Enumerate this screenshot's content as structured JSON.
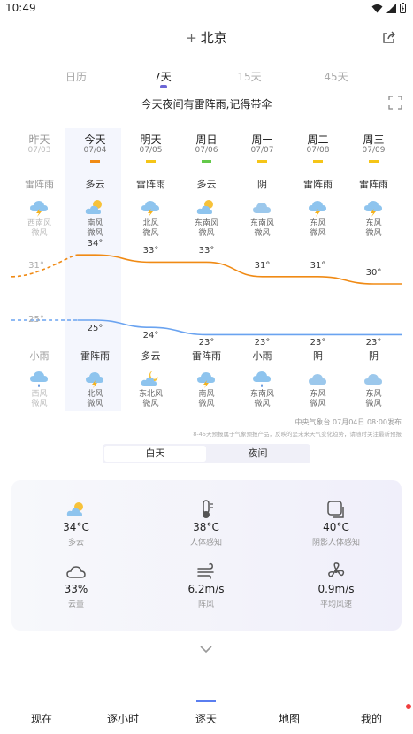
{
  "status_bar": {
    "time": "10:49"
  },
  "header": {
    "plus": "+",
    "city": "北京"
  },
  "tabs": [
    "日历",
    "7天",
    "15天",
    "45天"
  ],
  "notice": "今天夜间有雷阵雨,记得带伞",
  "forecast": [
    {
      "day": "昨天",
      "date": "07/03",
      "bar_color": "",
      "day_cond": "雷阵雨",
      "day_icon": "thunderstorm-icon",
      "day_wind": "西南风",
      "day_level": "微风",
      "high": "31°",
      "low": "25°",
      "night_cond": "小雨",
      "night_icon": "light-rain-icon",
      "night_wind": "西风",
      "night_level": "微风"
    },
    {
      "day": "今天",
      "date": "07/04",
      "bar_color": "#f08a14",
      "day_cond": "多云",
      "day_icon": "partly-cloudy-icon",
      "day_wind": "南风",
      "day_level": "微风",
      "high": "34°",
      "low": "25°",
      "night_cond": "雷阵雨",
      "night_icon": "thunderstorm-icon",
      "night_wind": "北风",
      "night_level": "微风"
    },
    {
      "day": "明天",
      "date": "07/05",
      "bar_color": "#f5c518",
      "day_cond": "雷阵雨",
      "day_icon": "thunderstorm-icon",
      "day_wind": "北风",
      "day_level": "微风",
      "high": "33°",
      "low": "24°",
      "night_cond": "多云",
      "night_icon": "partly-cloudy-night-icon",
      "night_wind": "东北风",
      "night_level": "微风"
    },
    {
      "day": "周日",
      "date": "07/06",
      "bar_color": "#63c94a",
      "day_cond": "多云",
      "day_icon": "partly-cloudy-icon",
      "day_wind": "东南风",
      "day_level": "微风",
      "high": "33°",
      "low": "23°",
      "night_cond": "雷阵雨",
      "night_icon": "thunderstorm-icon",
      "night_wind": "南风",
      "night_level": "微风"
    },
    {
      "day": "周一",
      "date": "07/07",
      "bar_color": "#f5c518",
      "day_cond": "阴",
      "day_icon": "overcast-icon",
      "day_wind": "东南风",
      "day_level": "微风",
      "high": "31°",
      "low": "23°",
      "night_cond": "小雨",
      "night_icon": "light-rain-icon",
      "night_wind": "东南风",
      "night_level": "微风"
    },
    {
      "day": "周二",
      "date": "07/08",
      "bar_color": "#f5c518",
      "day_cond": "雷阵雨",
      "day_icon": "thunderstorm-icon",
      "day_wind": "东风",
      "day_level": "微风",
      "high": "31°",
      "low": "23°",
      "night_cond": "阴",
      "night_icon": "overcast-icon",
      "night_wind": "东风",
      "night_level": "微风"
    },
    {
      "day": "周三",
      "date": "07/09",
      "bar_color": "#f5c518",
      "day_cond": "雷阵雨",
      "day_icon": "thunderstorm-icon",
      "day_wind": "东风",
      "day_level": "微风",
      "high": "30°",
      "low": "23°",
      "night_cond": "阴",
      "night_icon": "overcast-icon",
      "night_wind": "东风",
      "night_level": "微风"
    }
  ],
  "chart_data": {
    "type": "line",
    "categories": [
      "07/03",
      "07/04",
      "07/05",
      "07/06",
      "07/07",
      "07/08",
      "07/09"
    ],
    "series": [
      {
        "values": [
          31,
          34,
          33,
          33,
          31,
          31,
          30
        ],
        "color": "#f08a14"
      },
      {
        "values": [
          25,
          25,
          24,
          23,
          23,
          23,
          23
        ],
        "color": "#6aa3f0"
      }
    ]
  },
  "source": "中央气象台 07月04日 08:00发布",
  "disclaimer": "8-45天预报属于气象预报产品，反映的是未来天气变化趋势，请随时关注最新预报",
  "toggle": {
    "day": "白天",
    "night": "夜间"
  },
  "details": [
    {
      "icon": "partly-cloudy-icon",
      "value": "34°C",
      "label": "多云"
    },
    {
      "icon": "thermometer-icon",
      "value": "38°C",
      "label": "人体感知"
    },
    {
      "icon": "shade-icon",
      "value": "40°C",
      "label": "阴影人体感知"
    },
    {
      "icon": "cloud-icon",
      "value": "33%",
      "label": "云量"
    },
    {
      "icon": "wind-icon",
      "value": "6.2m/s",
      "label": "阵风"
    },
    {
      "icon": "fan-icon",
      "value": "0.9m/s",
      "label": "平均风速"
    }
  ],
  "nav": [
    "现在",
    "逐小时",
    "逐天",
    "地图",
    "我的"
  ]
}
